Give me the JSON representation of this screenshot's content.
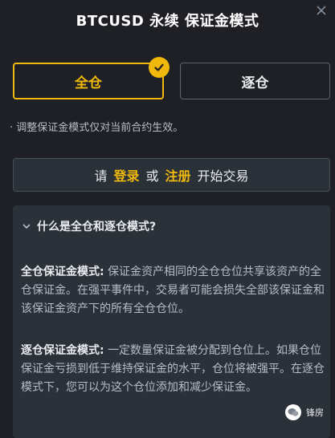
{
  "header": {
    "title": "BTCUSD 永续 保证金模式"
  },
  "modes": {
    "cross_label": "全仓",
    "isolated_label": "逐仓",
    "selected": "全仓"
  },
  "note": "· 调整保证金模式仅对当前合约生效。",
  "login_prompt": {
    "prefix": "请",
    "login": "登录",
    "or": "或",
    "register": "注册",
    "suffix": "开始交易"
  },
  "faq": {
    "question": "什么是全仓和逐仓模式?",
    "cross_term": "全仓保证金模式:",
    "cross_text": "保证金资产相同的全仓仓位共享该资产的全仓保证金。在强平事件中，交易者可能会损失全部该保证金和该保证金资产下的所有全仓仓位。",
    "isolated_term": "逐仓保证金模式:",
    "isolated_text": "一定数量保证金被分配到仓位上。如果仓位保证金亏损到低于维持保证金的水平，仓位将被强平。在逐仓模式下，您可以为这个仓位添加和减少保证金。"
  },
  "watermark": {
    "text": "锋房"
  },
  "colors": {
    "accent": "#f0b90b",
    "background": "#1e2026",
    "panel": "#2b3139"
  },
  "icons": {
    "close": "close-icon",
    "check": "check-icon",
    "chevron": "chevron-down-icon"
  }
}
